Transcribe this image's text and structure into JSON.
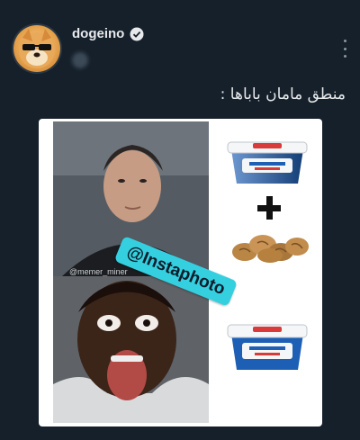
{
  "post": {
    "username": "dogeino",
    "caption": "منطق مامان باباها :",
    "verified": true
  },
  "image": {
    "watermark": "@Instaphoto",
    "credit": "@memer_miner",
    "products": [
      "butter-tub-icon",
      "plus-sign",
      "walnuts-pile",
      "butter-tub-icon"
    ]
  },
  "icons": {
    "verified": "verified-badge-icon",
    "more": "more-vertical-icon"
  },
  "colors": {
    "background": "#15202b",
    "watermark_bg": "#35d0e0"
  }
}
